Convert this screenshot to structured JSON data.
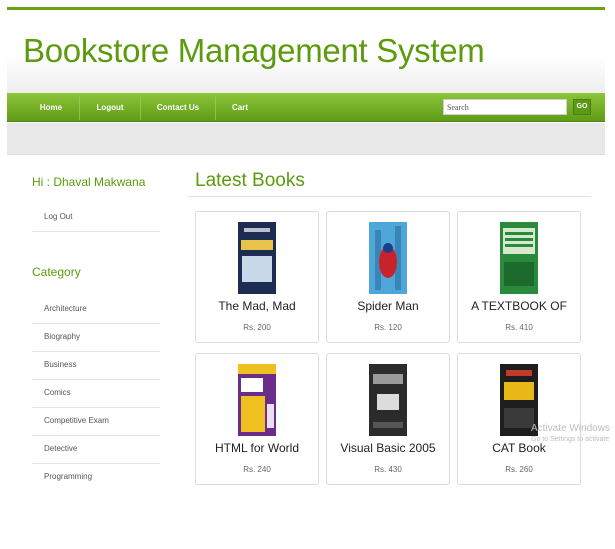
{
  "header": {
    "title": "Bookstore Management System"
  },
  "nav": {
    "items": [
      {
        "label": "Home"
      },
      {
        "label": "Logout"
      },
      {
        "label": "Contact Us"
      },
      {
        "label": "Cart"
      }
    ],
    "search_placeholder": "Search",
    "go_label": "GO"
  },
  "sidebar": {
    "greeting": "Hi : Dhaval Makwana",
    "logout_label": "Log Out",
    "category_heading": "Category",
    "categories": [
      "Architecture",
      "Biography",
      "Business",
      "Comics",
      "Competitive Exam",
      "Detective",
      "Programming"
    ]
  },
  "main": {
    "heading": "Latest Books",
    "books": [
      {
        "title": "The Mad, Mad",
        "price": "Rs. 200",
        "cover_colors": [
          "#1d2d52",
          "#e8c24a"
        ]
      },
      {
        "title": "Spider Man",
        "price": "Rs. 120",
        "cover_colors": [
          "#4fa6d8",
          "#c8232b"
        ]
      },
      {
        "title": "A TEXTBOOK OF",
        "price": "Rs. 410",
        "cover_colors": [
          "#2a8a3c",
          "#d8e8cf"
        ]
      },
      {
        "title": "HTML for World",
        "price": "Rs. 240",
        "cover_colors": [
          "#6b2d8c",
          "#f0c020"
        ]
      },
      {
        "title": "Visual Basic 2005",
        "price": "Rs. 430",
        "cover_colors": [
          "#2b2b2b",
          "#9a9a9a"
        ]
      },
      {
        "title": "CAT Book",
        "price": "Rs. 260",
        "cover_colors": [
          "#1e1e1e",
          "#e7b816"
        ]
      }
    ]
  },
  "watermark": {
    "line1": "Activate Windows",
    "line2": "Go to Settings to activate"
  }
}
